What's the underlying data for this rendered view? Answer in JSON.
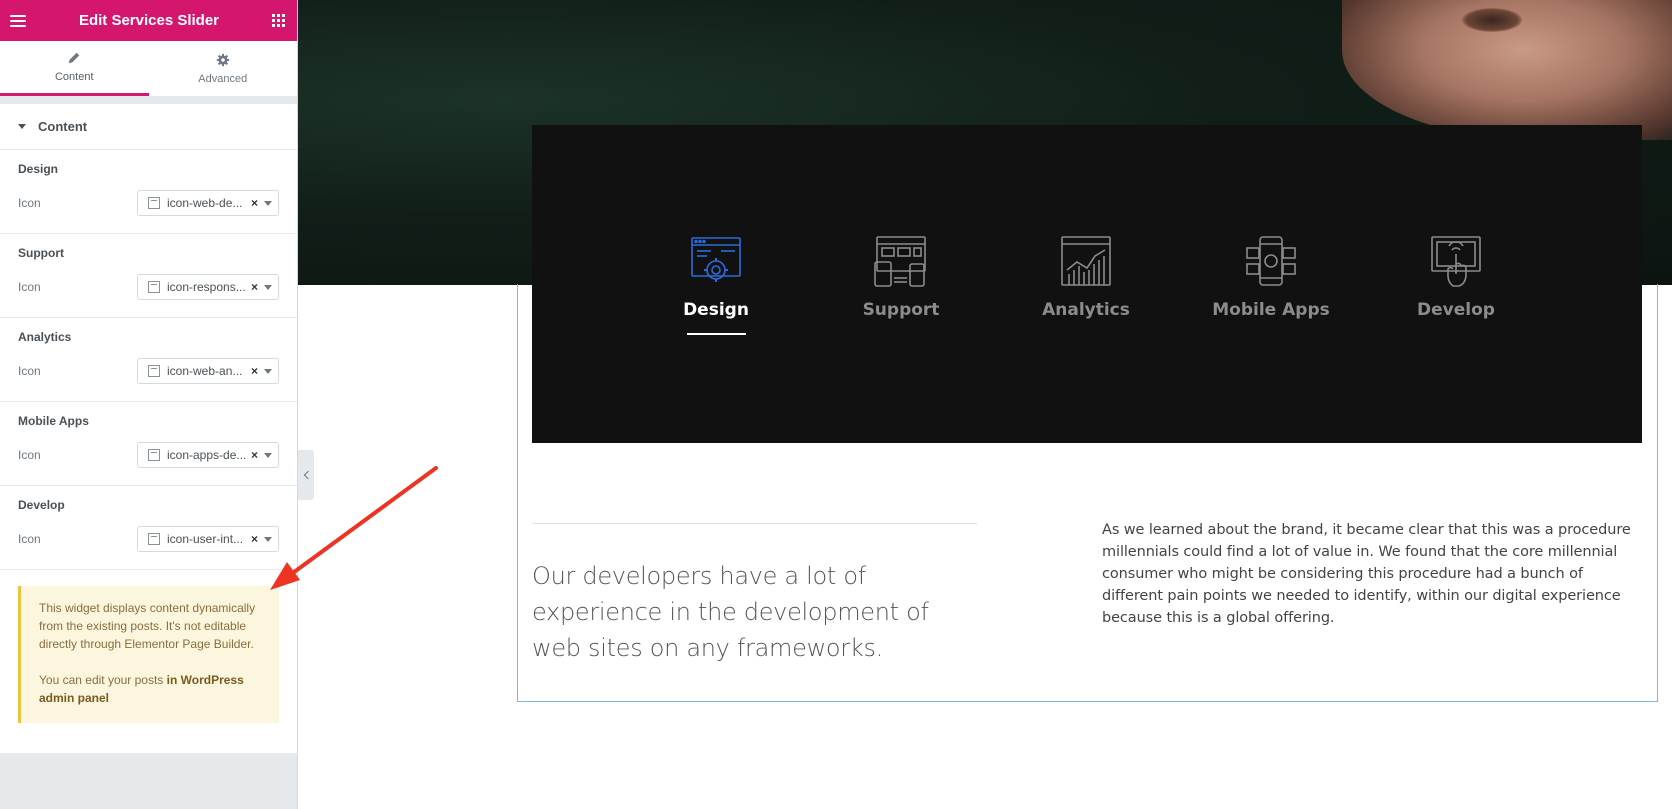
{
  "editor": {
    "title": "Edit Services Slider",
    "tabs": [
      {
        "label": "Content",
        "icon": "pencil-icon",
        "active": true
      },
      {
        "label": "Advanced",
        "icon": "gear-icon",
        "active": false
      }
    ],
    "section_title": "Content",
    "groups": [
      {
        "title": "Design",
        "field_label": "Icon",
        "value": "icon-web-de..."
      },
      {
        "title": "Support",
        "field_label": "Icon",
        "value": "icon-respons..."
      },
      {
        "title": "Analytics",
        "field_label": "Icon",
        "value": "icon-web-an..."
      },
      {
        "title": "Mobile Apps",
        "field_label": "Icon",
        "value": "icon-apps-de..."
      },
      {
        "title": "Develop",
        "field_label": "Icon",
        "value": "icon-user-int..."
      }
    ],
    "clear_symbol": "×",
    "notice": {
      "text1": "This widget displays content dynamically from the existing posts. It's not editable directly through Elementor Page Builder.",
      "text2_prefix": "You can edit your posts ",
      "text2_link": "in WordPress admin panel"
    },
    "accent_color": "#d5166e"
  },
  "preview": {
    "services": [
      {
        "name": "Design",
        "icon": "web-design-icon",
        "active": true
      },
      {
        "name": "Support",
        "icon": "responsive-layout-icon",
        "active": false
      },
      {
        "name": "Analytics",
        "icon": "web-analytics-icon",
        "active": false
      },
      {
        "name": "Mobile Apps",
        "icon": "apps-development-icon",
        "active": false
      },
      {
        "name": "Develop",
        "icon": "touch-interface-icon",
        "active": false
      }
    ],
    "lead_text": "Our developers have a lot of experience in the development of web sites on any frameworks.",
    "body_text": "As we learned about the brand, it became clear that this was a procedure millennials could find a lot of value in. We found that the core millennial consumer who might be considering this procedure had a bunch of different pain points we needed to identify, within our digital experience because this is a global offering.",
    "active_icon_color": "#2a6dd9"
  }
}
